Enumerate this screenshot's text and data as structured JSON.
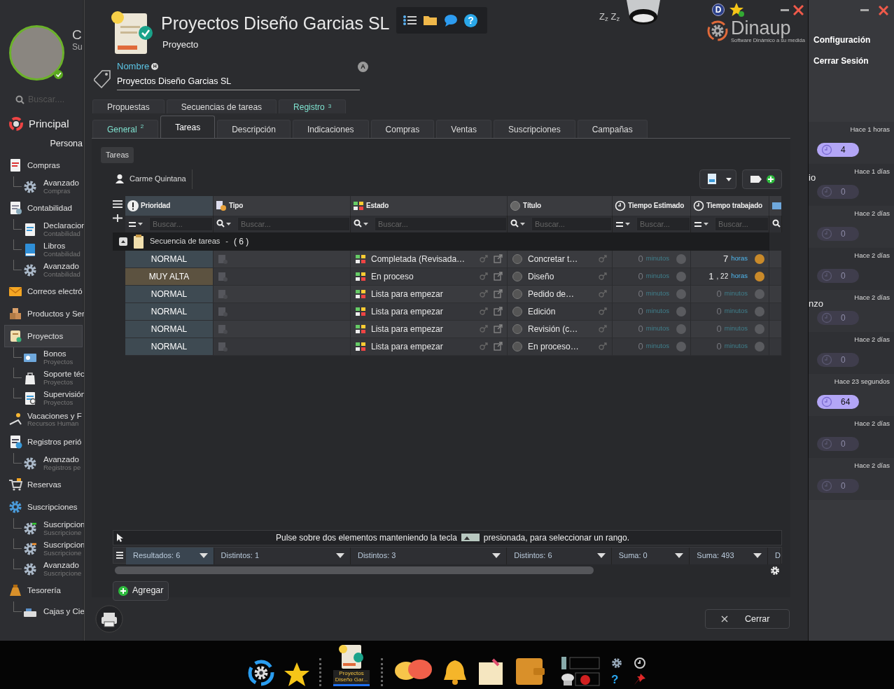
{
  "sidebar": {
    "user_initial": "C",
    "user_sub": "Su",
    "search_placeholder": "Buscar....",
    "home": "Principal",
    "section": "Persona",
    "items": [
      {
        "label": "Compras",
        "selected": false,
        "children": [
          {
            "label": "Avanzado",
            "sub": "Compras"
          }
        ]
      },
      {
        "label": "Contabilidad",
        "selected": false,
        "children": [
          {
            "label": "Declaracion",
            "sub": "Contabilidad"
          },
          {
            "label": "Libros",
            "sub": "Contabilidad"
          },
          {
            "label": "Avanzado",
            "sub": "Contabilidad"
          }
        ]
      },
      {
        "label": "Correos electró",
        "selected": false
      },
      {
        "label": "Productos y Ser",
        "selected": false
      },
      {
        "label": "Proyectos",
        "selected": true,
        "children": [
          {
            "label": "Bonos",
            "sub": "Proyectos"
          },
          {
            "label": "Soporte téc",
            "sub": "Proyectos"
          },
          {
            "label": "Supervisión",
            "sub": "Proyectos"
          }
        ]
      },
      {
        "label": "Vacaciones y F",
        "sub": "Recursos Human",
        "selected": false
      },
      {
        "label": "Registros perió",
        "selected": false,
        "children": [
          {
            "label": "Avanzado",
            "sub": "Registros pe"
          }
        ]
      },
      {
        "label": "Reservas",
        "selected": false
      },
      {
        "label": "Suscripciones",
        "selected": false,
        "children": [
          {
            "label": "Suscripcion",
            "sub": "Suscripcione"
          },
          {
            "label": "Suscripcion",
            "sub": "Suscripcione"
          },
          {
            "label": "Avanzado",
            "sub": "Suscripcione"
          }
        ]
      },
      {
        "label": "Tesorería",
        "selected": false,
        "children": [
          {
            "label": "Cajas y Cie"
          }
        ]
      }
    ]
  },
  "right_panel": {
    "menu": [
      "Configuración",
      "Cerrar Sesión"
    ],
    "entries": [
      {
        "time": "Hace 1 horas",
        "count": "4",
        "active": true
      },
      {
        "time": "Hace 1 días",
        "count": "0",
        "active": false,
        "fragment": "io"
      },
      {
        "time": "Hace 2 días",
        "count": "0",
        "active": false
      },
      {
        "time": "Hace 2 días",
        "count": "0",
        "active": false
      },
      {
        "time": "Hace 2 días",
        "count": "0",
        "active": false,
        "fragment": "nzo"
      },
      {
        "time": "Hace 2 días",
        "count": "0",
        "active": false
      },
      {
        "time": "Hace 23 segundos",
        "count": "64",
        "active": true
      },
      {
        "time": "Hace 2 días",
        "count": "0",
        "active": false
      },
      {
        "time": "Hace 2 días",
        "count": "0",
        "active": false
      }
    ]
  },
  "dialog": {
    "title": "Proyectos Diseño Garcias SL",
    "subtitle": "Proyecto",
    "help_glyph": "?",
    "sleep_text": "Z$_{z}$ Z$_{z}$",
    "user_letter": "D",
    "logo": "Dinaup",
    "logo_tagline": "Software Dinámico a su medida",
    "field": {
      "label": "Nombre",
      "badge": "H",
      "value": "Proyectos Diseño Garcias SL",
      "side_badge": "A"
    },
    "tabs_top": [
      {
        "label": "Propuestas",
        "selected": false
      },
      {
        "label": "Secuencias de tareas",
        "selected": false
      },
      {
        "label": "Registro",
        "badge": "3",
        "selected": false
      }
    ],
    "tabs": [
      {
        "label": "General",
        "badge": "2",
        "selected": false
      },
      {
        "label": "Tareas",
        "selected": true
      },
      {
        "label": "Descripción",
        "selected": false
      },
      {
        "label": "Indicaciones",
        "selected": false
      },
      {
        "label": "Compras",
        "selected": false
      },
      {
        "label": "Ventas",
        "selected": false
      },
      {
        "label": "Suscripciones",
        "selected": false
      },
      {
        "label": "Campañas",
        "selected": false
      }
    ],
    "subtab": "Tareas",
    "user_filter": "Carme Quintana",
    "table": {
      "columns": [
        {
          "label": "Prioridad",
          "kind": "equals",
          "placeholder": "Buscar...",
          "sorted": true
        },
        {
          "label": "Tipo",
          "kind": "search",
          "placeholder": "Buscar...",
          "sorted": false
        },
        {
          "label": "Estado",
          "kind": "search",
          "placeholder": "Buscar...",
          "sorted": false
        },
        {
          "label": "Título",
          "kind": "search",
          "placeholder": "Buscar...",
          "sorted": false
        },
        {
          "label": "Tiempo Estimado",
          "kind": "equals",
          "placeholder": "Buscar...",
          "sorted": false
        },
        {
          "label": "Tiempo trabajado",
          "kind": "equals",
          "placeholder": "Buscar...",
          "sorted": false
        },
        {
          "kind": "search",
          "sorted": false
        }
      ],
      "group": {
        "label": "Secuencia de tareas",
        "dash": "-",
        "count": "( 6 )"
      },
      "rows": [
        {
          "priority": "NORMAL",
          "kind": "normal",
          "status": "Completada (Revisada…",
          "title": "Concretar t…",
          "estimated": {
            "value": "0",
            "unit": "minutos",
            "active": false
          },
          "worked": {
            "value": "7",
            "unit": "horas",
            "active": true
          }
        },
        {
          "priority": "MUY ALTA",
          "kind": "high",
          "status": "En proceso",
          "title": "Diseño",
          "estimated": {
            "value": "0",
            "unit": "minutos",
            "active": false
          },
          "worked": {
            "value": "1",
            "minor": ", 22",
            "unit": "horas",
            "active": true
          }
        },
        {
          "priority": "NORMAL",
          "kind": "normal",
          "status": "Lista para empezar",
          "title": "Pedido de…",
          "estimated": {
            "value": "0",
            "unit": "minutos",
            "active": false
          },
          "worked": {
            "value": "0",
            "unit": "minutos",
            "active": false
          }
        },
        {
          "priority": "NORMAL",
          "kind": "normal",
          "status": "Lista para empezar",
          "title": "Edición",
          "estimated": {
            "value": "0",
            "unit": "minutos",
            "active": false
          },
          "worked": {
            "value": "0",
            "unit": "minutos",
            "active": false
          }
        },
        {
          "priority": "NORMAL",
          "kind": "normal",
          "status": "Lista para empezar",
          "title": "Revisión (c…",
          "estimated": {
            "value": "0",
            "unit": "minutos",
            "active": false
          },
          "worked": {
            "value": "0",
            "unit": "minutos",
            "active": false
          }
        },
        {
          "priority": "NORMAL",
          "kind": "normal",
          "status": "Lista para empezar",
          "title": "En proceso…",
          "estimated": {
            "value": "0",
            "unit": "minutos",
            "active": false
          },
          "worked": {
            "value": "0",
            "unit": "minutos",
            "active": false
          }
        }
      ],
      "hint_before": "Pulse sobre dos elementos manteniendo la tecla",
      "hint_after": "presionada, para seleccionar un rango.",
      "summaries": [
        {
          "text": "Resultados: 6",
          "selected": true
        },
        {
          "text": "Distintos: 1",
          "selected": false
        },
        {
          "text": "Distintos: 3",
          "selected": false
        },
        {
          "text": "Distintos: 6",
          "selected": false
        },
        {
          "text": "Suma: 0",
          "selected": false
        },
        {
          "text": "Suma: 493",
          "selected": false
        },
        {
          "text": "D",
          "selected": false
        }
      ]
    },
    "add_button": "Agregar",
    "close_button": "Cerrar"
  },
  "taskbar": {
    "active_label": "Proyectos Diseño Gar...",
    "help_glyph": "?"
  }
}
